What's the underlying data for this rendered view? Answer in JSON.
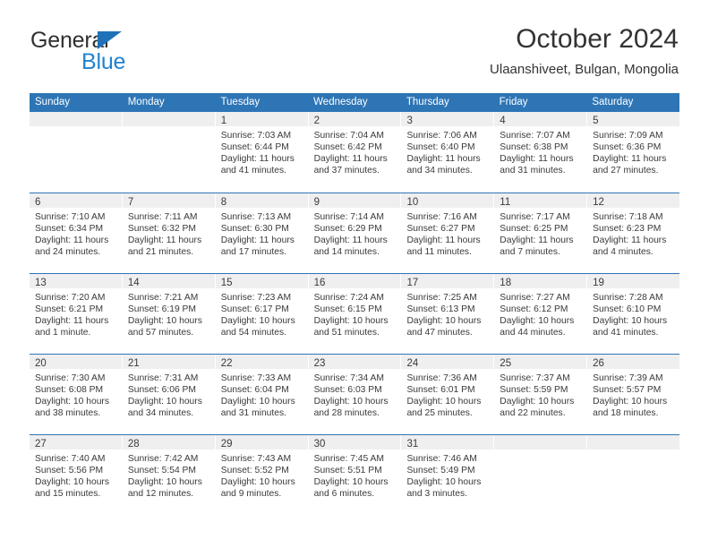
{
  "brand": {
    "name_part1": "General",
    "name_part2": "Blue"
  },
  "header": {
    "title": "October 2024",
    "subtitle": "Ulaanshiveet, Bulgan, Mongolia"
  },
  "colors": {
    "header_blue": "#2e75b6",
    "logo_blue": "#1f83d0",
    "daynum_strip": "#efefef",
    "text": "#3a3a3a"
  },
  "weekdays": [
    "Sunday",
    "Monday",
    "Tuesday",
    "Wednesday",
    "Thursday",
    "Friday",
    "Saturday"
  ],
  "weeks": [
    [
      {
        "day": "",
        "sunrise": "",
        "sunset": "",
        "daylight": "",
        "daylight2": ""
      },
      {
        "day": "",
        "sunrise": "",
        "sunset": "",
        "daylight": "",
        "daylight2": ""
      },
      {
        "day": "1",
        "sunrise": "Sunrise: 7:03 AM",
        "sunset": "Sunset: 6:44 PM",
        "daylight": "Daylight: 11 hours",
        "daylight2": "and 41 minutes."
      },
      {
        "day": "2",
        "sunrise": "Sunrise: 7:04 AM",
        "sunset": "Sunset: 6:42 PM",
        "daylight": "Daylight: 11 hours",
        "daylight2": "and 37 minutes."
      },
      {
        "day": "3",
        "sunrise": "Sunrise: 7:06 AM",
        "sunset": "Sunset: 6:40 PM",
        "daylight": "Daylight: 11 hours",
        "daylight2": "and 34 minutes."
      },
      {
        "day": "4",
        "sunrise": "Sunrise: 7:07 AM",
        "sunset": "Sunset: 6:38 PM",
        "daylight": "Daylight: 11 hours",
        "daylight2": "and 31 minutes."
      },
      {
        "day": "5",
        "sunrise": "Sunrise: 7:09 AM",
        "sunset": "Sunset: 6:36 PM",
        "daylight": "Daylight: 11 hours",
        "daylight2": "and 27 minutes."
      }
    ],
    [
      {
        "day": "6",
        "sunrise": "Sunrise: 7:10 AM",
        "sunset": "Sunset: 6:34 PM",
        "daylight": "Daylight: 11 hours",
        "daylight2": "and 24 minutes."
      },
      {
        "day": "7",
        "sunrise": "Sunrise: 7:11 AM",
        "sunset": "Sunset: 6:32 PM",
        "daylight": "Daylight: 11 hours",
        "daylight2": "and 21 minutes."
      },
      {
        "day": "8",
        "sunrise": "Sunrise: 7:13 AM",
        "sunset": "Sunset: 6:30 PM",
        "daylight": "Daylight: 11 hours",
        "daylight2": "and 17 minutes."
      },
      {
        "day": "9",
        "sunrise": "Sunrise: 7:14 AM",
        "sunset": "Sunset: 6:29 PM",
        "daylight": "Daylight: 11 hours",
        "daylight2": "and 14 minutes."
      },
      {
        "day": "10",
        "sunrise": "Sunrise: 7:16 AM",
        "sunset": "Sunset: 6:27 PM",
        "daylight": "Daylight: 11 hours",
        "daylight2": "and 11 minutes."
      },
      {
        "day": "11",
        "sunrise": "Sunrise: 7:17 AM",
        "sunset": "Sunset: 6:25 PM",
        "daylight": "Daylight: 11 hours",
        "daylight2": "and 7 minutes."
      },
      {
        "day": "12",
        "sunrise": "Sunrise: 7:18 AM",
        "sunset": "Sunset: 6:23 PM",
        "daylight": "Daylight: 11 hours",
        "daylight2": "and 4 minutes."
      }
    ],
    [
      {
        "day": "13",
        "sunrise": "Sunrise: 7:20 AM",
        "sunset": "Sunset: 6:21 PM",
        "daylight": "Daylight: 11 hours",
        "daylight2": "and 1 minute."
      },
      {
        "day": "14",
        "sunrise": "Sunrise: 7:21 AM",
        "sunset": "Sunset: 6:19 PM",
        "daylight": "Daylight: 10 hours",
        "daylight2": "and 57 minutes."
      },
      {
        "day": "15",
        "sunrise": "Sunrise: 7:23 AM",
        "sunset": "Sunset: 6:17 PM",
        "daylight": "Daylight: 10 hours",
        "daylight2": "and 54 minutes."
      },
      {
        "day": "16",
        "sunrise": "Sunrise: 7:24 AM",
        "sunset": "Sunset: 6:15 PM",
        "daylight": "Daylight: 10 hours",
        "daylight2": "and 51 minutes."
      },
      {
        "day": "17",
        "sunrise": "Sunrise: 7:25 AM",
        "sunset": "Sunset: 6:13 PM",
        "daylight": "Daylight: 10 hours",
        "daylight2": "and 47 minutes."
      },
      {
        "day": "18",
        "sunrise": "Sunrise: 7:27 AM",
        "sunset": "Sunset: 6:12 PM",
        "daylight": "Daylight: 10 hours",
        "daylight2": "and 44 minutes."
      },
      {
        "day": "19",
        "sunrise": "Sunrise: 7:28 AM",
        "sunset": "Sunset: 6:10 PM",
        "daylight": "Daylight: 10 hours",
        "daylight2": "and 41 minutes."
      }
    ],
    [
      {
        "day": "20",
        "sunrise": "Sunrise: 7:30 AM",
        "sunset": "Sunset: 6:08 PM",
        "daylight": "Daylight: 10 hours",
        "daylight2": "and 38 minutes."
      },
      {
        "day": "21",
        "sunrise": "Sunrise: 7:31 AM",
        "sunset": "Sunset: 6:06 PM",
        "daylight": "Daylight: 10 hours",
        "daylight2": "and 34 minutes."
      },
      {
        "day": "22",
        "sunrise": "Sunrise: 7:33 AM",
        "sunset": "Sunset: 6:04 PM",
        "daylight": "Daylight: 10 hours",
        "daylight2": "and 31 minutes."
      },
      {
        "day": "23",
        "sunrise": "Sunrise: 7:34 AM",
        "sunset": "Sunset: 6:03 PM",
        "daylight": "Daylight: 10 hours",
        "daylight2": "and 28 minutes."
      },
      {
        "day": "24",
        "sunrise": "Sunrise: 7:36 AM",
        "sunset": "Sunset: 6:01 PM",
        "daylight": "Daylight: 10 hours",
        "daylight2": "and 25 minutes."
      },
      {
        "day": "25",
        "sunrise": "Sunrise: 7:37 AM",
        "sunset": "Sunset: 5:59 PM",
        "daylight": "Daylight: 10 hours",
        "daylight2": "and 22 minutes."
      },
      {
        "day": "26",
        "sunrise": "Sunrise: 7:39 AM",
        "sunset": "Sunset: 5:57 PM",
        "daylight": "Daylight: 10 hours",
        "daylight2": "and 18 minutes."
      }
    ],
    [
      {
        "day": "27",
        "sunrise": "Sunrise: 7:40 AM",
        "sunset": "Sunset: 5:56 PM",
        "daylight": "Daylight: 10 hours",
        "daylight2": "and 15 minutes."
      },
      {
        "day": "28",
        "sunrise": "Sunrise: 7:42 AM",
        "sunset": "Sunset: 5:54 PM",
        "daylight": "Daylight: 10 hours",
        "daylight2": "and 12 minutes."
      },
      {
        "day": "29",
        "sunrise": "Sunrise: 7:43 AM",
        "sunset": "Sunset: 5:52 PM",
        "daylight": "Daylight: 10 hours",
        "daylight2": "and 9 minutes."
      },
      {
        "day": "30",
        "sunrise": "Sunrise: 7:45 AM",
        "sunset": "Sunset: 5:51 PM",
        "daylight": "Daylight: 10 hours",
        "daylight2": "and 6 minutes."
      },
      {
        "day": "31",
        "sunrise": "Sunrise: 7:46 AM",
        "sunset": "Sunset: 5:49 PM",
        "daylight": "Daylight: 10 hours",
        "daylight2": "and 3 minutes."
      },
      {
        "day": "",
        "sunrise": "",
        "sunset": "",
        "daylight": "",
        "daylight2": ""
      },
      {
        "day": "",
        "sunrise": "",
        "sunset": "",
        "daylight": "",
        "daylight2": ""
      }
    ]
  ]
}
